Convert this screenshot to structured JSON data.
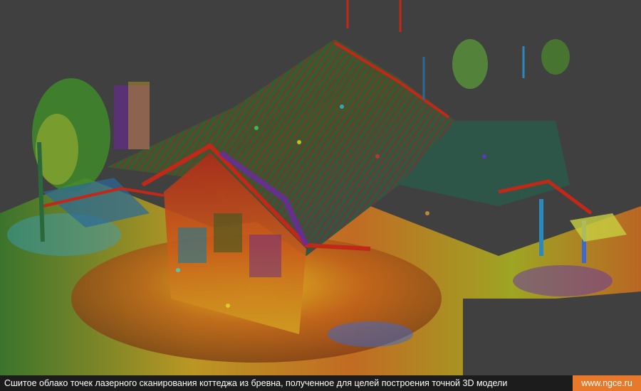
{
  "caption": {
    "text": "Сшитое облако точек лазерного сканирования коттеджа из бревна, полученное для целей построения точной 3D модели",
    "url": "www.ngce.ru"
  },
  "colors": {
    "background": "#404040",
    "caption_bar": "#1c1c1c",
    "url_badge": "#e9792a"
  }
}
